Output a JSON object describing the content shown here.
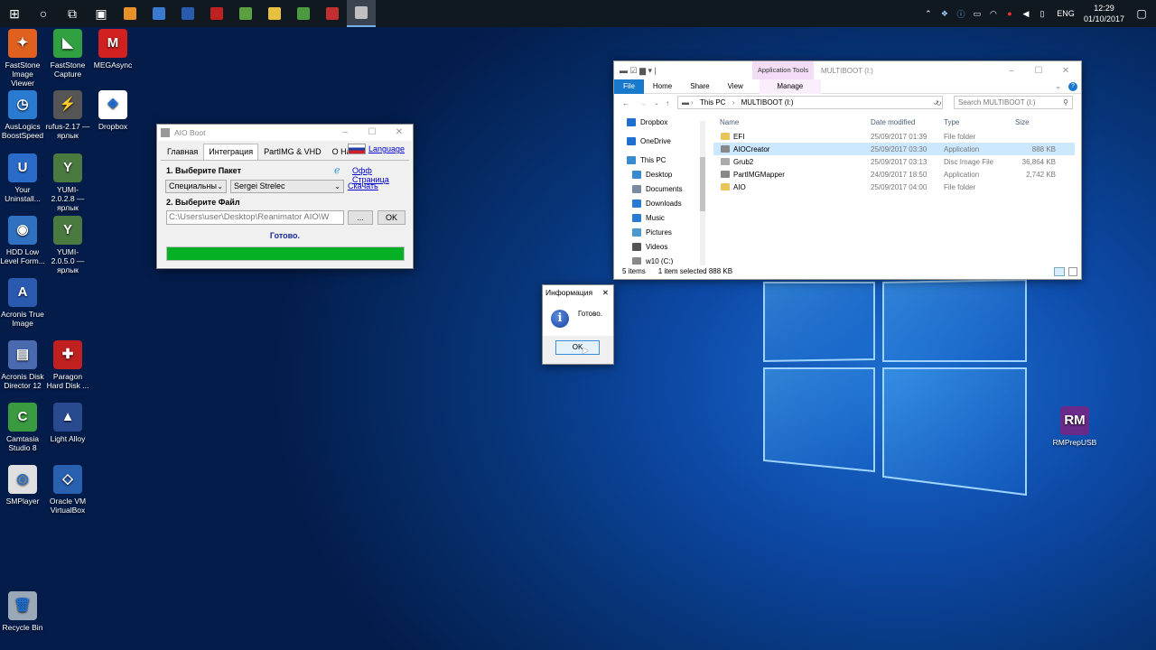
{
  "taskbar": {
    "apps": [
      {
        "icon": "start-icon",
        "color": "#ffffff"
      },
      {
        "icon": "search-icon",
        "color": "#ffffff"
      },
      {
        "icon": "task-view-icon",
        "color": "#ffffff"
      },
      {
        "icon": "store-icon",
        "color": "#ffffff"
      },
      {
        "icon": "app-icon",
        "color": "#e8902a"
      },
      {
        "icon": "app-icon",
        "color": "#3a7ad0"
      },
      {
        "icon": "photoshop-icon",
        "color": "#2a5ab0"
      },
      {
        "icon": "cherry-icon",
        "color": "#c02020"
      },
      {
        "icon": "app-icon",
        "color": "#5aa040"
      },
      {
        "icon": "file-explorer-icon",
        "color": "#e8c040"
      },
      {
        "icon": "chrome-icon",
        "color": "#4a9a40"
      },
      {
        "icon": "app-icon",
        "color": "#c03030"
      },
      {
        "icon": "aio-boot-icon",
        "color": "#c0c0c0"
      }
    ],
    "language": "ENG",
    "time": "12:29",
    "date": "01/10/2017"
  },
  "desktop_icons": [
    {
      "label": "FastStone Image Viewer",
      "color": "#e06020",
      "glyph": "✦"
    },
    {
      "label": "FastStone Capture",
      "color": "#30a040",
      "glyph": "◣"
    },
    {
      "label": "MEGAsync",
      "color": "#d02020",
      "glyph": "M"
    },
    {
      "label": "AusLogics BoostSpeed",
      "color": "#2a7ad0",
      "glyph": "◷"
    },
    {
      "label": "rufus-2.17 — ярлык",
      "color": "#555555",
      "glyph": "⚡"
    },
    {
      "label": "Dropbox",
      "color": "#ffffff",
      "glyph": "❖"
    },
    {
      "label": "Your Uninstall...",
      "color": "#2a6ac8",
      "glyph": "U"
    },
    {
      "label": "YUMI-2.0.2.8 — ярлык",
      "color": "#4a7a40",
      "glyph": "Y"
    },
    {
      "label": "HDD Low Level Form...",
      "color": "#3070c0",
      "glyph": "◉"
    },
    {
      "label": "YUMI-2.0.5.0 — ярлык",
      "color": "#4a7a40",
      "glyph": "Y"
    },
    {
      "label": "Acronis True Image",
      "color": "#2a5ab0",
      "glyph": "A"
    },
    {
      "label": "Acronis Disk Director 12",
      "color": "#4a6ab0",
      "glyph": "▤"
    },
    {
      "label": "Paragon Hard Disk ...",
      "color": "#c02020",
      "glyph": "✚"
    },
    {
      "label": "Camtasia Studio 8",
      "color": "#3a9a40",
      "glyph": "C"
    },
    {
      "label": "Light Alloy",
      "color": "#2a4a90",
      "glyph": "▲"
    },
    {
      "label": "SMPlayer",
      "color": "#e0e0e0",
      "glyph": "◎"
    },
    {
      "label": "Oracle VM VirtualBox",
      "color": "#2a60b0",
      "glyph": "◇"
    },
    {
      "label": "RMPrepUSB",
      "color": "#6a2a8a",
      "glyph": "RM"
    },
    {
      "label": "Recycle Bin",
      "color": "#9aa8b8",
      "glyph": "🗑"
    }
  ],
  "aio": {
    "title": "AIO Boot",
    "tabs": [
      "Главная",
      "Интеграция",
      "PartIMG & VHD",
      "О Нас!"
    ],
    "language_link": "Language",
    "step1_label": "1. Выберите Пакет",
    "official_page_link": "Офф Страница",
    "category_value": "Специальны",
    "package_value": "Sergei Strelec",
    "download_link": "Скачать",
    "step2_label": "2. Выберите Файл",
    "file_path": "C:\\Users\\user\\Desktop\\Reanimator AIO\\W",
    "browse_label": "...",
    "ok_label": "OK",
    "status": "Готово.",
    "progress": 1.0,
    "progress_color": "#06b025"
  },
  "explorer": {
    "title": "MULTIBOOT (I:)",
    "app_tools": "Application Tools",
    "ribbon_tabs": [
      "File",
      "Home",
      "Share",
      "View",
      "Manage"
    ],
    "breadcrumb": [
      "This PC",
      "MULTIBOOT (I:)"
    ],
    "search_placeholder": "Search MULTIBOOT (I:)",
    "nav_items": [
      {
        "label": "Dropbox",
        "icon": "dropbox-icon",
        "color": "#1e6fd0"
      },
      {
        "label": "OneDrive",
        "icon": "onedrive-icon",
        "color": "#1e6fd0"
      },
      {
        "label": "This PC",
        "icon": "computer-icon",
        "color": "#3a8ad0"
      },
      {
        "label": "Desktop",
        "icon": "desktop-icon",
        "color": "#3a8ad0"
      },
      {
        "label": "Documents",
        "icon": "documents-icon",
        "color": "#7a8aa0"
      },
      {
        "label": "Downloads",
        "icon": "downloads-icon",
        "color": "#2a7ad0"
      },
      {
        "label": "Music",
        "icon": "music-icon",
        "color": "#2a7ad0"
      },
      {
        "label": "Pictures",
        "icon": "pictures-icon",
        "color": "#4a9ad0"
      },
      {
        "label": "Videos",
        "icon": "videos-icon",
        "color": "#555555"
      },
      {
        "label": "w10 (C:)",
        "icon": "drive-icon",
        "color": "#888888"
      }
    ],
    "columns": [
      "Name",
      "Date modified",
      "Type",
      "Size"
    ],
    "files": [
      {
        "name": "EFI",
        "date": "25/09/2017 01:39",
        "type": "File folder",
        "size": "",
        "icon": "folder-icon"
      },
      {
        "name": "AIOCreator",
        "date": "25/09/2017 03:30",
        "type": "Application",
        "size": "888 KB",
        "icon": "application-icon",
        "selected": true
      },
      {
        "name": "Grub2",
        "date": "25/09/2017 03:13",
        "type": "Disc Image File",
        "size": "36,864 KB",
        "icon": "disc-image-icon"
      },
      {
        "name": "PartIMGMapper",
        "date": "24/09/2017 18:50",
        "type": "Application",
        "size": "2,742 KB",
        "icon": "application-icon"
      },
      {
        "name": "AIO",
        "date": "25/09/2017 04:00",
        "type": "File folder",
        "size": "",
        "icon": "folder-icon"
      }
    ],
    "status_items": "5 items",
    "status_selected": "1 item selected  888 KB"
  },
  "dialog": {
    "title": "Информация",
    "message": "Готово.",
    "ok_label": "OK"
  }
}
